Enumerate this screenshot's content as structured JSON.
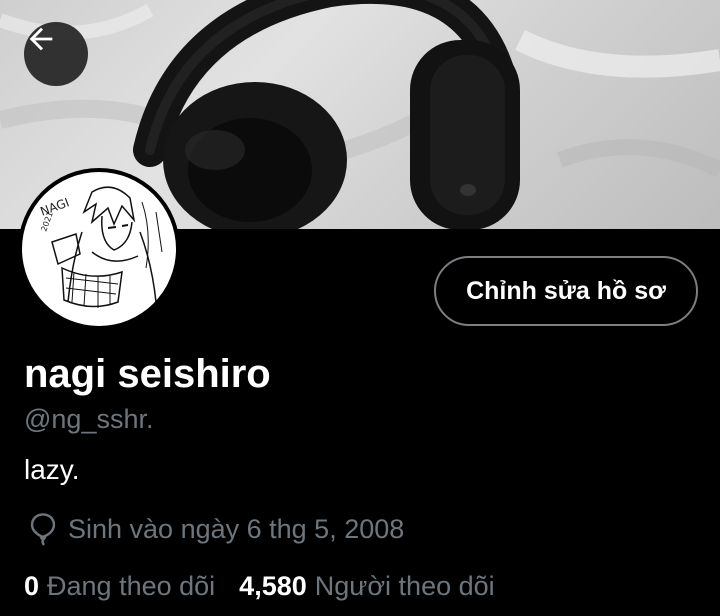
{
  "header": {
    "back_icon": "arrow-left-icon",
    "banner_image": "black-headphones-on-white-cloth"
  },
  "profile": {
    "avatar_image": "manga-sketch-avatar",
    "edit_button_label": "Chỉnh sửa hồ sơ",
    "display_name": "nagi seishiro",
    "handle": "@ng_sshr.",
    "bio": "lazy.",
    "birthday_icon": "balloon-icon",
    "birthday_text": "Sinh vào ngày 6 thg 5, 2008"
  },
  "stats": {
    "following_count": "0",
    "following_label": "Đang theo dõi",
    "followers_count": "4,580",
    "followers_label": "Người theo dõi"
  },
  "colors": {
    "background": "#000000",
    "text_primary": "#ffffff",
    "text_secondary": "#6e767d",
    "button_border": "#7a7f84"
  }
}
